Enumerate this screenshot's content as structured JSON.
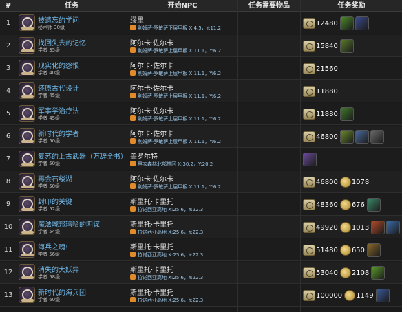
{
  "headers": {
    "num": "#",
    "quest": "任务",
    "npc": "开始NPC",
    "items": "任务需要物品",
    "reward": "任务奖励"
  },
  "rows": [
    {
      "num": "1",
      "name": "被遗忘的学问",
      "sub": "秘术师 30级",
      "npc": "缪里",
      "loc": "利姆萨·罗敏萨下层甲板 X:4.5，Y:11.2",
      "exp": "12480",
      "gil": "",
      "items": [
        "#4a8a2a",
        "#3a4a8a"
      ]
    },
    {
      "num": "2",
      "name": "找回失去的记忆",
      "sub": "学者 35级",
      "npc": "阿尔卡·佐尔卡",
      "loc": "利姆萨·罗敏萨上层甲板 X:11.1，Y:6.2",
      "exp": "15840",
      "gil": "",
      "items": [
        "#5a7a2a"
      ]
    },
    {
      "num": "3",
      "name": "现实化的怨恨",
      "sub": "学者 40级",
      "npc": "阿尔卡·佐尔卡",
      "loc": "利姆萨·罗敏萨上层甲板 X:11.1，Y:6.2",
      "exp": "21560",
      "gil": "",
      "items": []
    },
    {
      "num": "4",
      "name": "还原古代设计",
      "sub": "学者 45级",
      "npc": "阿尔卡·佐尔卡",
      "loc": "利姆萨·罗敏萨上层甲板 X:11.1，Y:6.2",
      "exp": "11880",
      "gil": "",
      "items": []
    },
    {
      "num": "5",
      "name": "军事学治疗法",
      "sub": "学者 45级",
      "npc": "阿尔卡·佐尔卡",
      "loc": "利姆萨·罗敏萨上层甲板 X:11.1，Y:6.2",
      "exp": "11880",
      "gil": "",
      "items": [
        "#3f7a2a"
      ]
    },
    {
      "num": "6",
      "name": "新时代的学者",
      "sub": "学者 50级",
      "npc": "阿尔卡·佐尔卡",
      "loc": "利姆萨·罗敏萨上层甲板 X:11.1，Y:6.2",
      "exp": "46800",
      "gil": "",
      "items": [
        "#6a8a2a",
        "#4a6a9a",
        "#6a6a6a"
      ]
    },
    {
      "num": "7",
      "name": "复苏的上古武器（万辞全书）",
      "sub": "学者 50级",
      "npc": "盖罗尔特",
      "loc": "黑衣森林北部林区 X:30.2，Y:20.2",
      "exp": "",
      "gil": "",
      "items": [
        "#6a4a9a"
      ]
    },
    {
      "num": "8",
      "name": "再会石缕湖",
      "sub": "学者 50级",
      "npc": "阿尔卡·佐尔卡",
      "loc": "利姆萨·罗敏萨上层甲板 X:11.1，Y:6.2",
      "exp": "46800",
      "gil": "1078",
      "items": []
    },
    {
      "num": "9",
      "name": "封印的关键",
      "sub": "学者 52级",
      "npc": "斯里托·卡里托",
      "loc": "拉诺西亚高地 X:25.6，Y:22.3",
      "exp": "48360",
      "gil": "676",
      "items": [
        "#3a8a6a"
      ]
    },
    {
      "num": "10",
      "name": "魔法城邦玛哈的阴谋",
      "sub": "学者 54级",
      "npc": "斯里托·卡里托",
      "loc": "拉诺西亚高地 X:25.6，Y:22.3",
      "exp": "49920",
      "gil": "1013",
      "items": [
        "#b04a2a",
        "#3a6aaa"
      ]
    },
    {
      "num": "11",
      "name": "海兵之魂!",
      "sub": "学者 56级",
      "npc": "斯里托·卡里托",
      "loc": "拉诺西亚高地 X:25.6，Y:22.3",
      "exp": "51480",
      "gil": "650",
      "items": [
        "#8a6a2a"
      ]
    },
    {
      "num": "12",
      "name": "消失的大妖异",
      "sub": "学者 58级",
      "npc": "斯里托·卡里托",
      "loc": "拉诺西亚高地 X:25.6，Y:22.3",
      "exp": "53040",
      "gil": "2108",
      "items": [
        "#5a9a2a"
      ]
    },
    {
      "num": "13",
      "name": "新时代的海兵团",
      "sub": "学者 60级",
      "npc": "斯里托·卡里托",
      "loc": "拉诺西亚高地 X:25.6，Y:22.3",
      "exp": "100000",
      "gil": "1149",
      "items": [
        "#3a5a9a"
      ]
    }
  ]
}
